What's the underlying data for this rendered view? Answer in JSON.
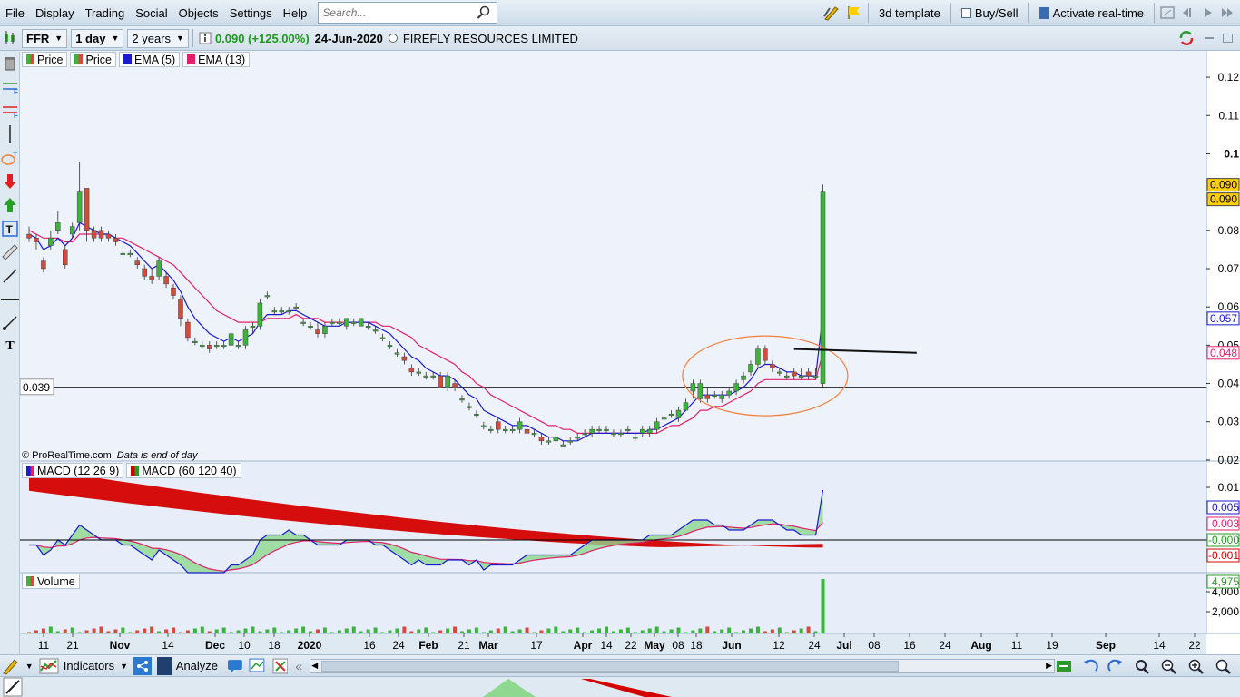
{
  "menubar": {
    "items": [
      "File",
      "Display",
      "Trading",
      "Social",
      "Objects",
      "Settings",
      "Help"
    ],
    "search_placeholder": "Search...",
    "template_label": "3d template",
    "buysell_label": "Buy/Sell",
    "realtime_label": "Activate real-time"
  },
  "toolbar": {
    "ticker": "FFR",
    "interval": "1 day",
    "period": "2 years",
    "price_change": "0.090 (+125.00%)",
    "date": "24-Jun-2020",
    "company": "FIREFLY RESOURCES LIMITED"
  },
  "price_panel": {
    "legend": [
      "Price",
      "Price",
      "EMA (5)",
      "EMA (13)"
    ],
    "watermark_brand": "© ProRealTime.com",
    "watermark_note": "Data is end of day",
    "hline_label": "0.039",
    "y_ticks": [
      "0.12",
      "0.11",
      "0.1",
      "0.08",
      "0.07",
      "0.06",
      "0.05",
      "0.04",
      "0.03",
      "0.02"
    ],
    "tags": [
      "0.090",
      "0.090",
      "0.057",
      "0.048"
    ]
  },
  "macd_panel": {
    "legend": [
      "MACD (12 26 9)",
      "MACD (60 120 40)"
    ],
    "y_ticks": [
      "0.01",
      "-0.000"
    ],
    "tags": [
      "0.005",
      "0.003",
      "-0.000",
      "-0.001"
    ]
  },
  "volume_panel": {
    "legend": [
      "Volume"
    ],
    "y_ticks": [
      "4,000",
      "2,000"
    ],
    "tag": "4,975"
  },
  "x_axis": [
    {
      "label": "11",
      "bold": false
    },
    {
      "label": "21",
      "bold": false
    },
    {
      "label": "Nov",
      "bold": true
    },
    {
      "label": "14",
      "bold": false
    },
    {
      "label": "Dec",
      "bold": true
    },
    {
      "label": "10",
      "bold": false
    },
    {
      "label": "18",
      "bold": false
    },
    {
      "label": "2020",
      "bold": true
    },
    {
      "label": "16",
      "bold": false
    },
    {
      "label": "24",
      "bold": false
    },
    {
      "label": "Feb",
      "bold": true
    },
    {
      "label": "21",
      "bold": false
    },
    {
      "label": "Mar",
      "bold": true
    },
    {
      "label": "17",
      "bold": false
    },
    {
      "label": "Apr",
      "bold": true
    },
    {
      "label": "14",
      "bold": false
    },
    {
      "label": "22",
      "bold": false
    },
    {
      "label": "May",
      "bold": true
    },
    {
      "label": "08",
      "bold": false
    },
    {
      "label": "18",
      "bold": false
    },
    {
      "label": "Jun",
      "bold": true
    },
    {
      "label": "12",
      "bold": false
    },
    {
      "label": "24",
      "bold": false
    },
    {
      "label": "Jul",
      "bold": true
    },
    {
      "label": "08",
      "bold": false
    },
    {
      "label": "16",
      "bold": false
    },
    {
      "label": "24",
      "bold": false
    },
    {
      "label": "Aug",
      "bold": true
    },
    {
      "label": "11",
      "bold": false
    },
    {
      "label": "19",
      "bold": false
    },
    {
      "label": "Sep",
      "bold": true
    },
    {
      "label": "14",
      "bold": false
    },
    {
      "label": "22",
      "bold": false
    }
  ],
  "bottombar": {
    "indicators_label": "Indicators",
    "analyze_label": "Analyze"
  },
  "colors": {
    "up": "#3cb43c",
    "down": "#d24b3c",
    "ema5": "#1a1acf",
    "ema13": "#e0206a",
    "ribbon_red": "#d40000",
    "ribbon_green": "#8fd88f",
    "circle": "#f08040"
  },
  "chart_data": {
    "type": "candlestick",
    "ylim": [
      0.015,
      0.125
    ],
    "candles": [
      [
        0.079,
        0.081,
        0.077,
        0.078
      ],
      [
        0.078,
        0.079,
        0.075,
        0.077
      ],
      [
        0.072,
        0.073,
        0.069,
        0.07
      ],
      [
        0.076,
        0.08,
        0.075,
        0.078
      ],
      [
        0.08,
        0.085,
        0.079,
        0.082
      ],
      [
        0.075,
        0.076,
        0.07,
        0.071
      ],
      [
        0.079,
        0.082,
        0.078,
        0.081
      ],
      [
        0.082,
        0.098,
        0.08,
        0.09
      ],
      [
        0.091,
        0.091,
        0.077,
        0.08
      ],
      [
        0.08,
        0.081,
        0.077,
        0.078
      ],
      [
        0.08,
        0.081,
        0.077,
        0.078
      ],
      [
        0.079,
        0.08,
        0.077,
        0.078
      ],
      [
        0.078,
        0.079,
        0.076,
        0.077
      ],
      [
        0.074,
        0.075,
        0.073,
        0.074
      ],
      [
        0.074,
        0.075,
        0.073,
        0.074
      ],
      [
        0.072,
        0.073,
        0.07,
        0.071
      ],
      [
        0.07,
        0.071,
        0.067,
        0.068
      ],
      [
        0.068,
        0.07,
        0.066,
        0.067
      ],
      [
        0.068,
        0.073,
        0.067,
        0.072
      ],
      [
        0.068,
        0.069,
        0.065,
        0.066
      ],
      [
        0.065,
        0.066,
        0.062,
        0.063
      ],
      [
        0.062,
        0.063,
        0.055,
        0.057
      ],
      [
        0.056,
        0.057,
        0.051,
        0.052
      ],
      [
        0.051,
        0.052,
        0.05,
        0.051
      ],
      [
        0.05,
        0.051,
        0.049,
        0.05
      ],
      [
        0.05,
        0.051,
        0.048,
        0.049
      ],
      [
        0.05,
        0.051,
        0.049,
        0.05
      ],
      [
        0.05,
        0.051,
        0.049,
        0.05
      ],
      [
        0.05,
        0.054,
        0.049,
        0.053
      ],
      [
        0.05,
        0.051,
        0.049,
        0.05
      ],
      [
        0.05,
        0.055,
        0.049,
        0.054
      ],
      [
        0.055,
        0.056,
        0.053,
        0.055
      ],
      [
        0.055,
        0.062,
        0.054,
        0.061
      ],
      [
        0.063,
        0.064,
        0.062,
        0.063
      ],
      [
        0.059,
        0.06,
        0.058,
        0.059
      ],
      [
        0.059,
        0.06,
        0.058,
        0.059
      ],
      [
        0.059,
        0.06,
        0.058,
        0.059
      ],
      [
        0.06,
        0.061,
        0.059,
        0.06
      ],
      [
        0.056,
        0.057,
        0.055,
        0.056
      ],
      [
        0.055,
        0.056,
        0.054,
        0.055
      ],
      [
        0.054,
        0.056,
        0.052,
        0.053
      ],
      [
        0.053,
        0.056,
        0.052,
        0.055
      ],
      [
        0.056,
        0.057,
        0.055,
        0.056
      ],
      [
        0.056,
        0.057,
        0.055,
        0.056
      ],
      [
        0.055,
        0.057,
        0.054,
        0.057
      ],
      [
        0.056,
        0.057,
        0.055,
        0.056
      ],
      [
        0.055,
        0.057,
        0.055,
        0.057
      ],
      [
        0.055,
        0.056,
        0.054,
        0.055
      ],
      [
        0.054,
        0.055,
        0.053,
        0.054
      ],
      [
        0.052,
        0.053,
        0.051,
        0.052
      ],
      [
        0.05,
        0.051,
        0.049,
        0.05
      ],
      [
        0.048,
        0.049,
        0.047,
        0.048
      ],
      [
        0.047,
        0.048,
        0.045,
        0.046
      ],
      [
        0.044,
        0.045,
        0.042,
        0.043
      ],
      [
        0.043,
        0.044,
        0.042,
        0.043
      ],
      [
        0.042,
        0.043,
        0.041,
        0.042
      ],
      [
        0.042,
        0.043,
        0.041,
        0.042
      ],
      [
        0.042,
        0.043,
        0.039,
        0.039
      ],
      [
        0.039,
        0.043,
        0.038,
        0.042
      ],
      [
        0.04,
        0.041,
        0.038,
        0.039
      ],
      [
        0.036,
        0.037,
        0.035,
        0.036
      ],
      [
        0.034,
        0.035,
        0.033,
        0.034
      ],
      [
        0.032,
        0.033,
        0.031,
        0.032
      ],
      [
        0.029,
        0.03,
        0.028,
        0.029
      ],
      [
        0.028,
        0.029,
        0.027,
        0.028
      ],
      [
        0.03,
        0.031,
        0.027,
        0.028
      ],
      [
        0.028,
        0.029,
        0.027,
        0.028
      ],
      [
        0.028,
        0.029,
        0.027,
        0.028
      ],
      [
        0.028,
        0.031,
        0.027,
        0.03
      ],
      [
        0.028,
        0.029,
        0.026,
        0.027
      ],
      [
        0.027,
        0.028,
        0.026,
        0.027
      ],
      [
        0.026,
        0.027,
        0.024,
        0.025
      ],
      [
        0.025,
        0.026,
        0.024,
        0.025
      ],
      [
        0.025,
        0.027,
        0.024,
        0.026
      ],
      [
        0.024,
        0.025,
        0.024,
        0.024
      ],
      [
        0.025,
        0.026,
        0.024,
        0.025
      ],
      [
        0.026,
        0.027,
        0.025,
        0.026
      ],
      [
        0.027,
        0.028,
        0.026,
        0.027
      ],
      [
        0.027,
        0.029,
        0.026,
        0.028
      ],
      [
        0.028,
        0.029,
        0.027,
        0.028
      ],
      [
        0.028,
        0.029,
        0.027,
        0.028
      ],
      [
        0.027,
        0.028,
        0.026,
        0.027
      ],
      [
        0.027,
        0.028,
        0.026,
        0.027
      ],
      [
        0.028,
        0.029,
        0.027,
        0.028
      ],
      [
        0.026,
        0.027,
        0.025,
        0.026
      ],
      [
        0.027,
        0.029,
        0.026,
        0.028
      ],
      [
        0.027,
        0.029,
        0.026,
        0.028
      ],
      [
        0.028,
        0.031,
        0.027,
        0.03
      ],
      [
        0.031,
        0.032,
        0.03,
        0.031
      ],
      [
        0.032,
        0.033,
        0.031,
        0.032
      ],
      [
        0.031,
        0.034,
        0.03,
        0.033
      ],
      [
        0.033,
        0.036,
        0.033,
        0.035
      ],
      [
        0.038,
        0.041,
        0.036,
        0.04
      ],
      [
        0.036,
        0.041,
        0.035,
        0.04
      ],
      [
        0.037,
        0.039,
        0.035,
        0.036
      ],
      [
        0.037,
        0.038,
        0.036,
        0.037
      ],
      [
        0.036,
        0.038,
        0.035,
        0.037
      ],
      [
        0.037,
        0.039,
        0.036,
        0.038
      ],
      [
        0.038,
        0.041,
        0.037,
        0.04
      ],
      [
        0.041,
        0.043,
        0.04,
        0.042
      ],
      [
        0.043,
        0.046,
        0.042,
        0.045
      ],
      [
        0.045,
        0.05,
        0.044,
        0.049
      ],
      [
        0.049,
        0.05,
        0.045,
        0.046
      ],
      [
        0.045,
        0.046,
        0.043,
        0.044
      ],
      [
        0.043,
        0.044,
        0.042,
        0.043
      ],
      [
        0.042,
        0.043,
        0.041,
        0.042
      ],
      [
        0.043,
        0.044,
        0.041,
        0.042
      ],
      [
        0.042,
        0.044,
        0.041,
        0.042
      ],
      [
        0.043,
        0.044,
        0.041,
        0.042
      ],
      [
        0.042,
        0.044,
        0.041,
        0.042
      ],
      [
        0.04,
        0.092,
        0.039,
        0.09
      ]
    ],
    "ema5": [
      0.079,
      0.078,
      0.075,
      0.076,
      0.078,
      0.076,
      0.078,
      0.082,
      0.081,
      0.08,
      0.079,
      0.079,
      0.078,
      0.077,
      0.076,
      0.074,
      0.072,
      0.07,
      0.071,
      0.069,
      0.067,
      0.064,
      0.06,
      0.057,
      0.055,
      0.053,
      0.052,
      0.051,
      0.052,
      0.051,
      0.052,
      0.053,
      0.056,
      0.058,
      0.058,
      0.058,
      0.059,
      0.059,
      0.058,
      0.057,
      0.056,
      0.055,
      0.055,
      0.055,
      0.056,
      0.056,
      0.056,
      0.056,
      0.055,
      0.054,
      0.053,
      0.051,
      0.049,
      0.047,
      0.046,
      0.044,
      0.043,
      0.042,
      0.042,
      0.041,
      0.039,
      0.037,
      0.036,
      0.033,
      0.032,
      0.031,
      0.03,
      0.029,
      0.029,
      0.029,
      0.028,
      0.027,
      0.026,
      0.026,
      0.025,
      0.025,
      0.025,
      0.026,
      0.027,
      0.027,
      0.027,
      0.027,
      0.027,
      0.027,
      0.027,
      0.027,
      0.028,
      0.028,
      0.029,
      0.03,
      0.031,
      0.033,
      0.035,
      0.037,
      0.037,
      0.037,
      0.037,
      0.037,
      0.038,
      0.039,
      0.041,
      0.044,
      0.045,
      0.045,
      0.044,
      0.043,
      0.043,
      0.042,
      0.042,
      0.042,
      0.058
    ],
    "ema13": [
      0.08,
      0.079,
      0.078,
      0.078,
      0.078,
      0.077,
      0.077,
      0.079,
      0.079,
      0.079,
      0.079,
      0.079,
      0.078,
      0.078,
      0.077,
      0.076,
      0.075,
      0.074,
      0.073,
      0.072,
      0.071,
      0.069,
      0.067,
      0.065,
      0.063,
      0.061,
      0.059,
      0.058,
      0.057,
      0.056,
      0.056,
      0.056,
      0.056,
      0.057,
      0.057,
      0.057,
      0.057,
      0.058,
      0.057,
      0.057,
      0.057,
      0.056,
      0.056,
      0.056,
      0.056,
      0.056,
      0.056,
      0.056,
      0.056,
      0.055,
      0.055,
      0.054,
      0.053,
      0.052,
      0.05,
      0.049,
      0.048,
      0.047,
      0.046,
      0.045,
      0.043,
      0.042,
      0.04,
      0.039,
      0.037,
      0.036,
      0.035,
      0.034,
      0.033,
      0.032,
      0.031,
      0.03,
      0.029,
      0.029,
      0.028,
      0.028,
      0.027,
      0.027,
      0.027,
      0.027,
      0.027,
      0.027,
      0.027,
      0.027,
      0.027,
      0.027,
      0.027,
      0.027,
      0.028,
      0.029,
      0.029,
      0.03,
      0.031,
      0.033,
      0.033,
      0.034,
      0.034,
      0.035,
      0.036,
      0.037,
      0.038,
      0.04,
      0.041,
      0.041,
      0.041,
      0.041,
      0.041,
      0.041,
      0.041,
      0.041,
      0.048
    ],
    "hline": 0.039
  }
}
